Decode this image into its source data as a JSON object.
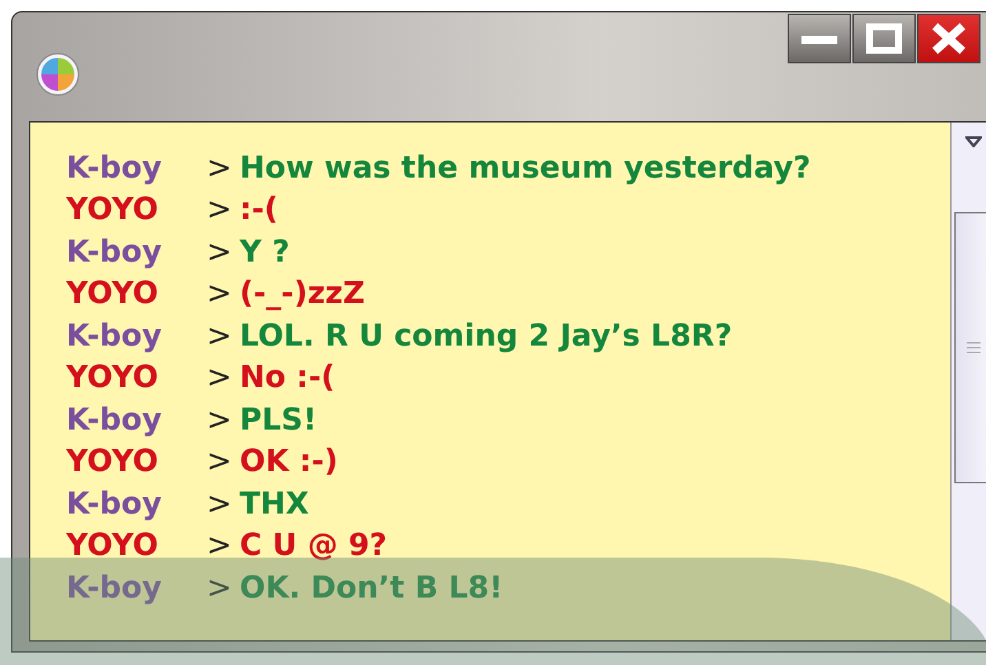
{
  "window": {
    "controls": [
      {
        "kind": "minimize"
      },
      {
        "kind": "maximize"
      },
      {
        "kind": "close"
      }
    ]
  },
  "messages": [
    {
      "kind": "a",
      "sender": "K-boy",
      "separator": ">",
      "text": "How was the museum yesterday?"
    },
    {
      "kind": "b",
      "sender": "YOYO",
      "separator": ">",
      "text": ":-("
    },
    {
      "kind": "a",
      "sender": "K-boy",
      "separator": ">",
      "text": "Y ?"
    },
    {
      "kind": "b",
      "sender": "YOYO",
      "separator": ">",
      "text": "(-_-)zzZ"
    },
    {
      "kind": "a",
      "sender": "K-boy",
      "separator": ">",
      "text": "LOL. R U coming 2 Jay’s L8R?"
    },
    {
      "kind": "b",
      "sender": "YOYO",
      "separator": ">",
      "text": "No :-("
    },
    {
      "kind": "a",
      "sender": "K-boy",
      "separator": ">",
      "text": "PLS!"
    },
    {
      "kind": "b",
      "sender": "YOYO",
      "separator": ">",
      "text": "OK :-)"
    },
    {
      "kind": "a",
      "sender": "K-boy",
      "separator": ">",
      "text": "THX"
    },
    {
      "kind": "b",
      "sender": "YOYO",
      "separator": ">",
      "text": "C U @ 9?"
    },
    {
      "kind": "a",
      "sender": "K-boy",
      "separator": ">",
      "text": "OK. Don’t B L8!"
    }
  ]
}
